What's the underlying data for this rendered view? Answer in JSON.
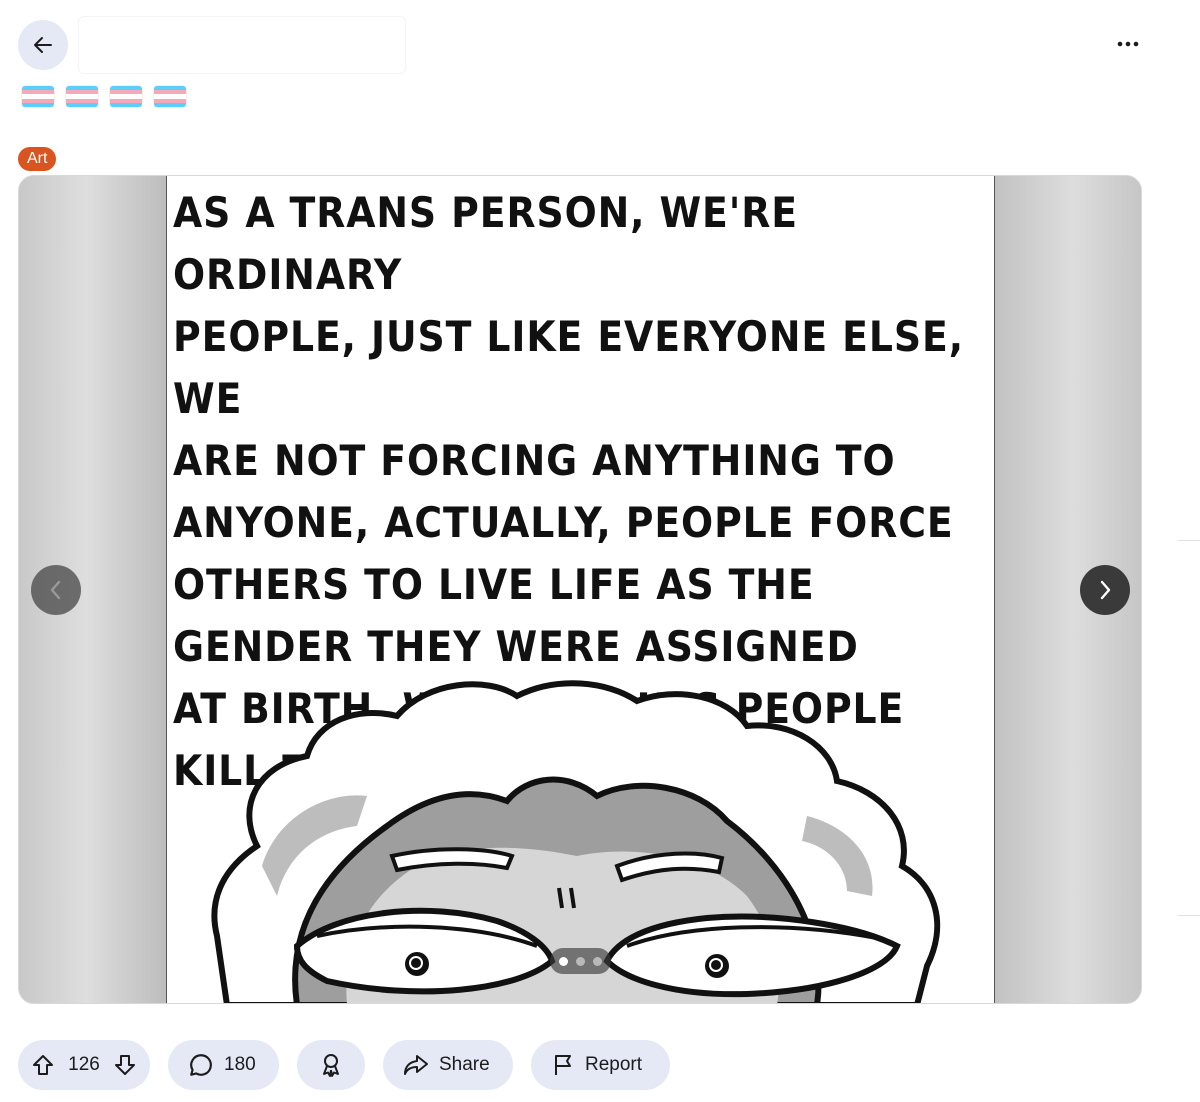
{
  "header": {
    "back_icon": "arrow-left-icon",
    "more_icon": "more-horizontal-icon",
    "flags": [
      {
        "name": "transgender-flag",
        "colors": [
          "#5BCEFA",
          "#F5A9B8",
          "#FFFFFF",
          "#F5A9B8",
          "#5BCEFA"
        ]
      },
      {
        "name": "transgender-flag",
        "colors": [
          "#5BCEFA",
          "#F5A9B8",
          "#FFFFFF",
          "#F5A9B8",
          "#5BCEFA"
        ]
      },
      {
        "name": "transgender-flag",
        "colors": [
          "#5BCEFA",
          "#F5A9B8",
          "#FFFFFF",
          "#F5A9B8",
          "#5BCEFA"
        ]
      },
      {
        "name": "transgender-flag",
        "colors": [
          "#5BCEFA",
          "#F5A9B8",
          "#FFFFFF",
          "#F5A9B8",
          "#5BCEFA"
        ]
      }
    ]
  },
  "post": {
    "flair": "Art",
    "flair_color": "#D9541E",
    "image_text_lines": [
      "AS A TRANS PERSON, WE'RE ORDINARY",
      "PEOPLE, JUST LIKE EVERYONE ELSE, WE",
      "ARE NOT FORCING ANYTHING TO",
      "ANYONE, ACTUALLY, PEOPLE FORCE",
      "OTHERS TO LIVE LIFE AS THE",
      "GENDER THEY WERE ASSIGNED",
      "AT BIRTH, WHICH MAKES PEOPLE",
      "KILL THEMSELVES"
    ],
    "gallery": {
      "prev_icon": "chevron-left-icon",
      "next_icon": "chevron-right-icon",
      "total_slides": 3,
      "current_slide": 1
    }
  },
  "actions": {
    "score": "126",
    "upvote_icon": "arrow-up-icon",
    "downvote_icon": "arrow-down-icon",
    "comments": "180",
    "comment_icon": "comment-bubble-icon",
    "award_icon": "award-icon",
    "share_label": "Share",
    "share_icon": "share-arrow-icon",
    "report_label": "Report",
    "report_icon": "flag-icon"
  },
  "colors": {
    "pill_bg": "#E5E9F6",
    "accent": "#D9541E"
  }
}
